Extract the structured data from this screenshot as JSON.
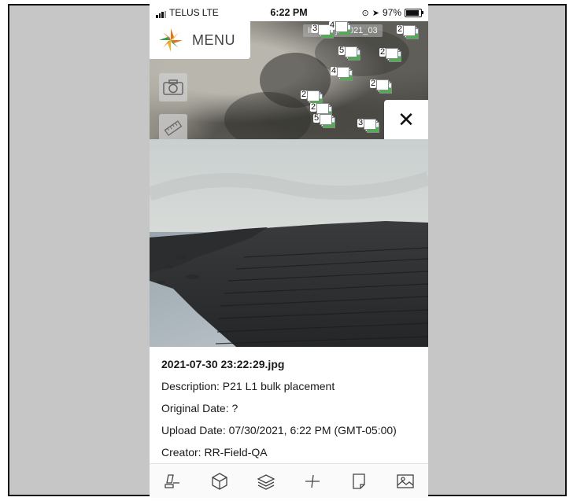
{
  "status_bar": {
    "carrier": "TELUS",
    "network": "LTE",
    "time": "6:22 PM",
    "battery": "97%"
  },
  "map": {
    "menu_label": "MENU",
    "imagery_layer": "Imagery_2021_03",
    "marker_counts": [
      "3",
      "4",
      "2",
      "2",
      "5",
      "4",
      "2",
      "2",
      "2",
      "5",
      "3"
    ]
  },
  "photo": {
    "filename": "2021-07-30 23:22:29.jpg",
    "description": "Description: P21 L1 bulk placement",
    "original_date": "Original Date: ?",
    "upload_date": "Upload Date: 07/30/2021, 6:22 PM (GMT-05:00)",
    "creator": "Creator: RR-Field-QA"
  },
  "close_symbol": "✕",
  "colors": {
    "accent_orange": "#e8731e",
    "accent_green": "#3a9c4a",
    "frame_gray": "#c6c6c6"
  },
  "toolbar_icons": [
    "markup-icon",
    "3d-box-icon",
    "layers-icon",
    "measure-icon",
    "note-icon",
    "image-icon"
  ]
}
